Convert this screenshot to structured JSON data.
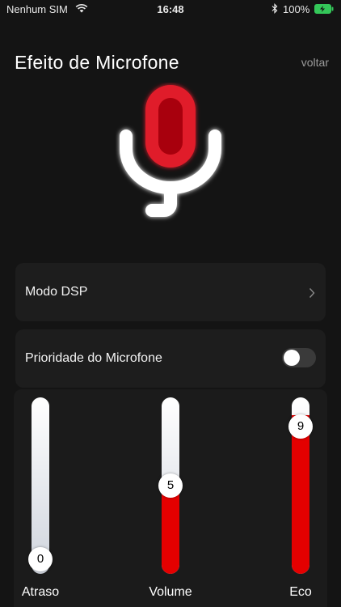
{
  "status_bar": {
    "carrier": "Nenhum SIM",
    "time": "16:48",
    "battery": "100%"
  },
  "header": {
    "title": "Efeito de Microfone",
    "back_label": "voltar"
  },
  "microphone": {
    "icon": "microphone-icon",
    "capsule_color": "#e01e2a",
    "stand_color": "#ffffff"
  },
  "settings": {
    "dsp_mode_label": "Modo DSP",
    "mic_priority_label": "Prioridade do Microfone",
    "mic_priority_on": false
  },
  "sliders": {
    "max": 10,
    "fill_color": "#e40000",
    "items": [
      {
        "label": "Atraso",
        "value": 0
      },
      {
        "label": "Volume",
        "value": 5
      },
      {
        "label": "Eco",
        "value": 9
      }
    ]
  }
}
